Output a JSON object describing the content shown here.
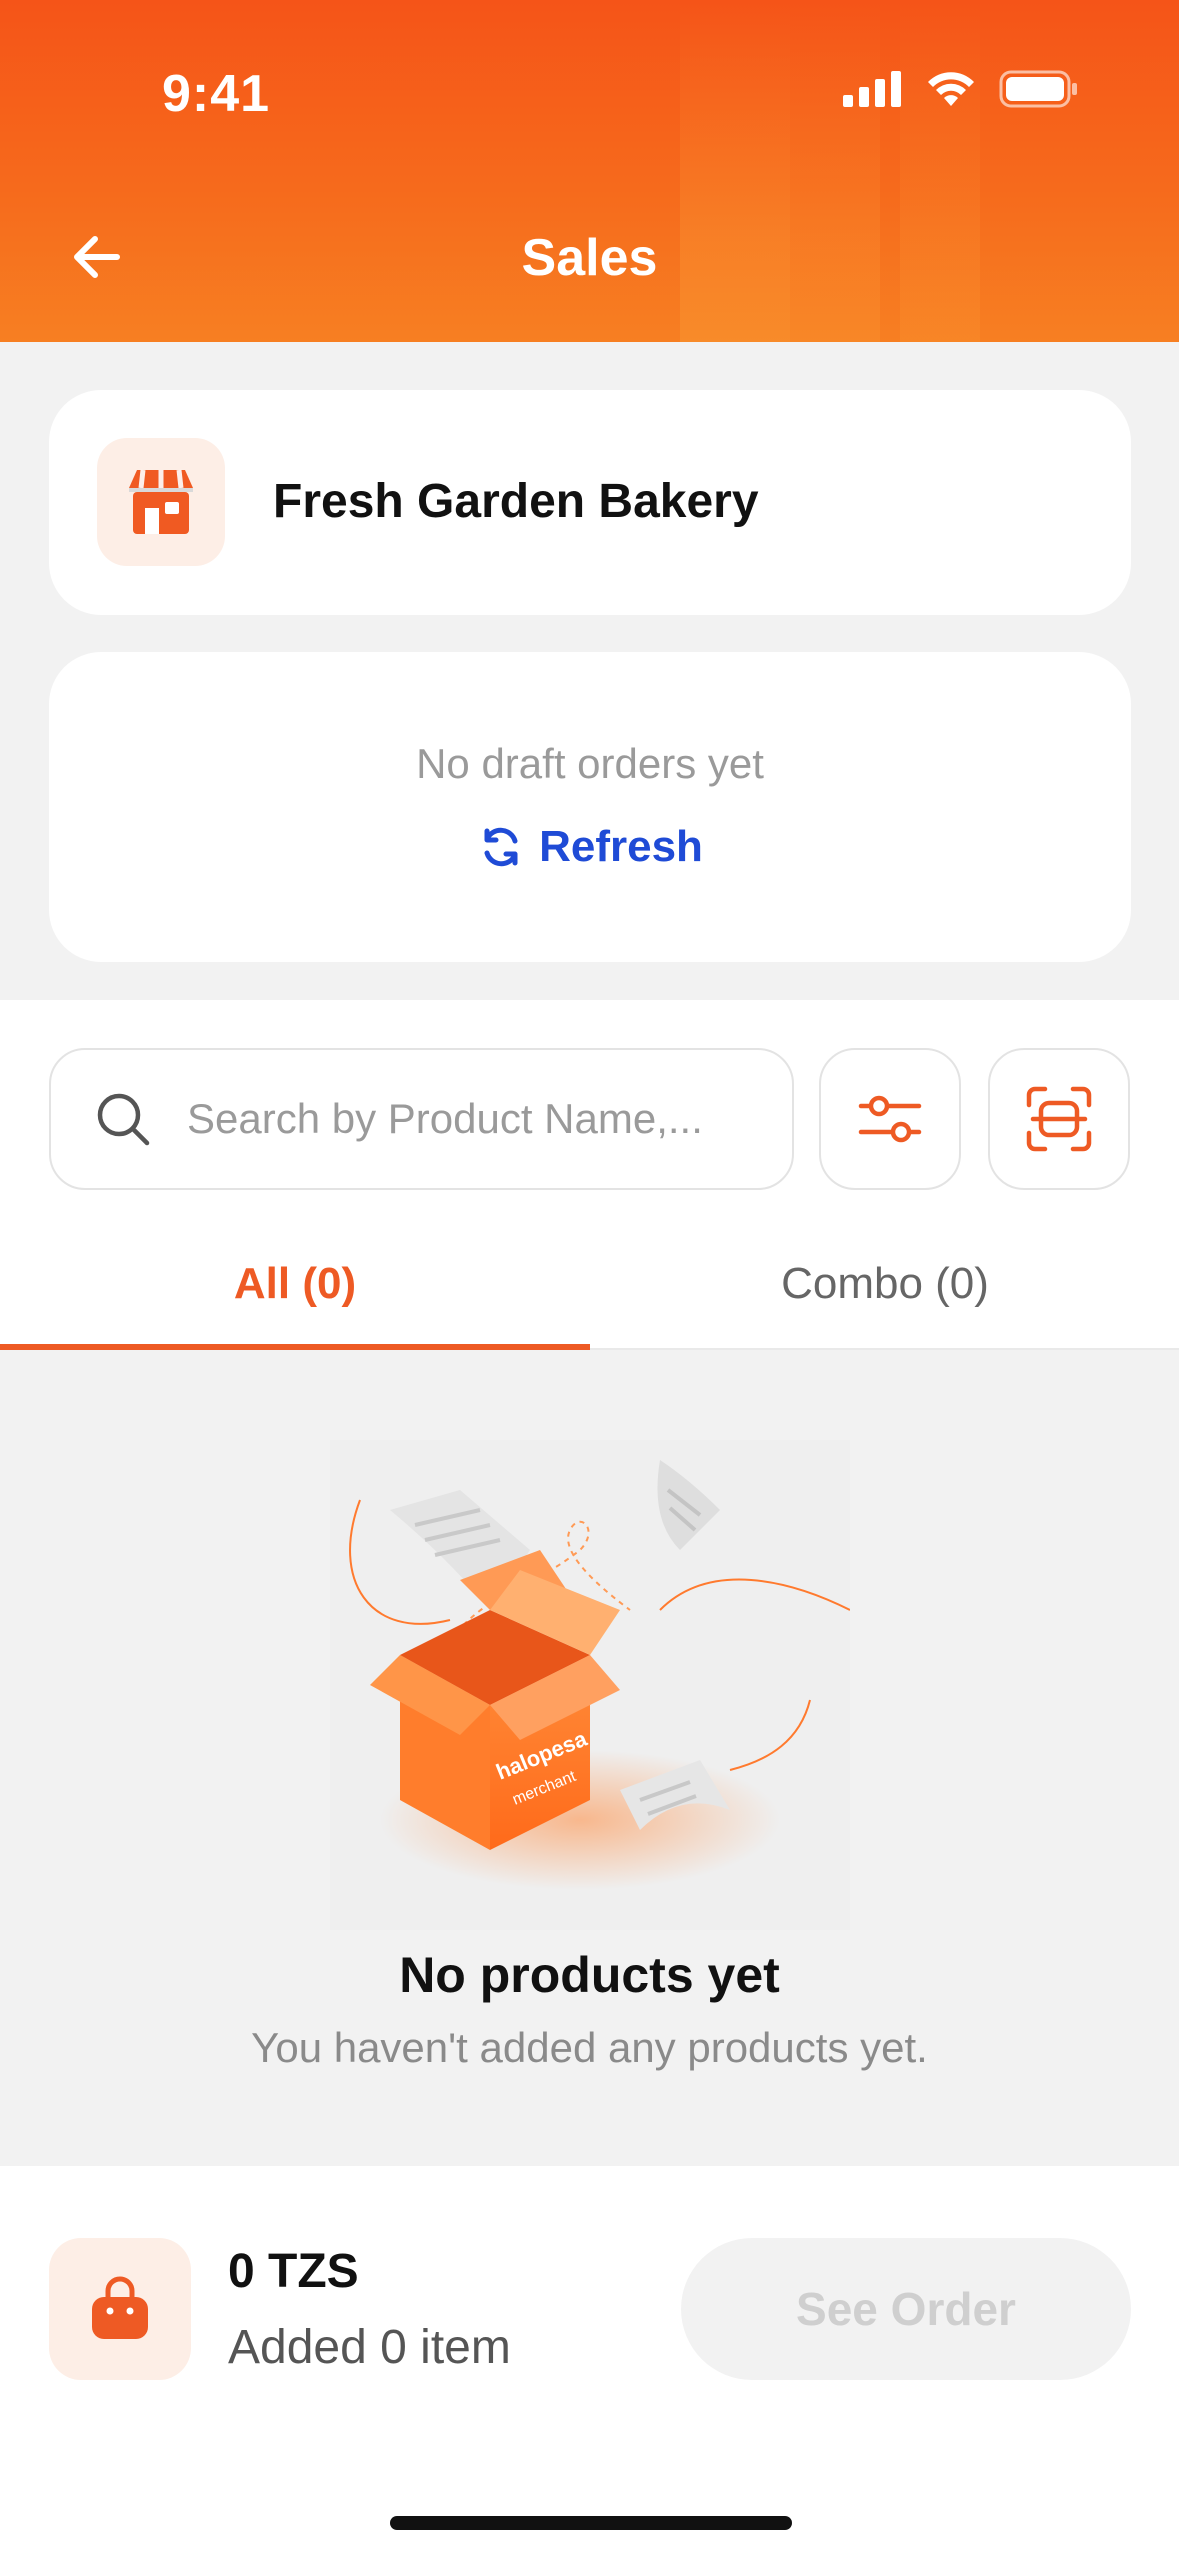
{
  "status_bar": {
    "time": "9:41"
  },
  "header": {
    "title": "Sales"
  },
  "store": {
    "name": "Fresh Garden Bakery"
  },
  "drafts": {
    "empty_text": "No draft orders yet",
    "refresh_label": "Refresh"
  },
  "search": {
    "placeholder": "Search by Product Name,..."
  },
  "tabs": [
    {
      "label": "All (0)",
      "active": true
    },
    {
      "label": "Combo (0)",
      "active": false
    }
  ],
  "empty_state": {
    "title": "No products yet",
    "subtitle": "You haven't added any products yet.",
    "box_brand": "halopesa",
    "box_sub": "merchant"
  },
  "order_bar": {
    "total": "0 TZS",
    "items_text": "Added 0 item",
    "see_order_label": "See Order"
  },
  "colors": {
    "accent": "#ee5a24",
    "header_top": "#f55418",
    "link_blue": "#1f4bd6",
    "disabled_text": "#cfcfcf"
  }
}
